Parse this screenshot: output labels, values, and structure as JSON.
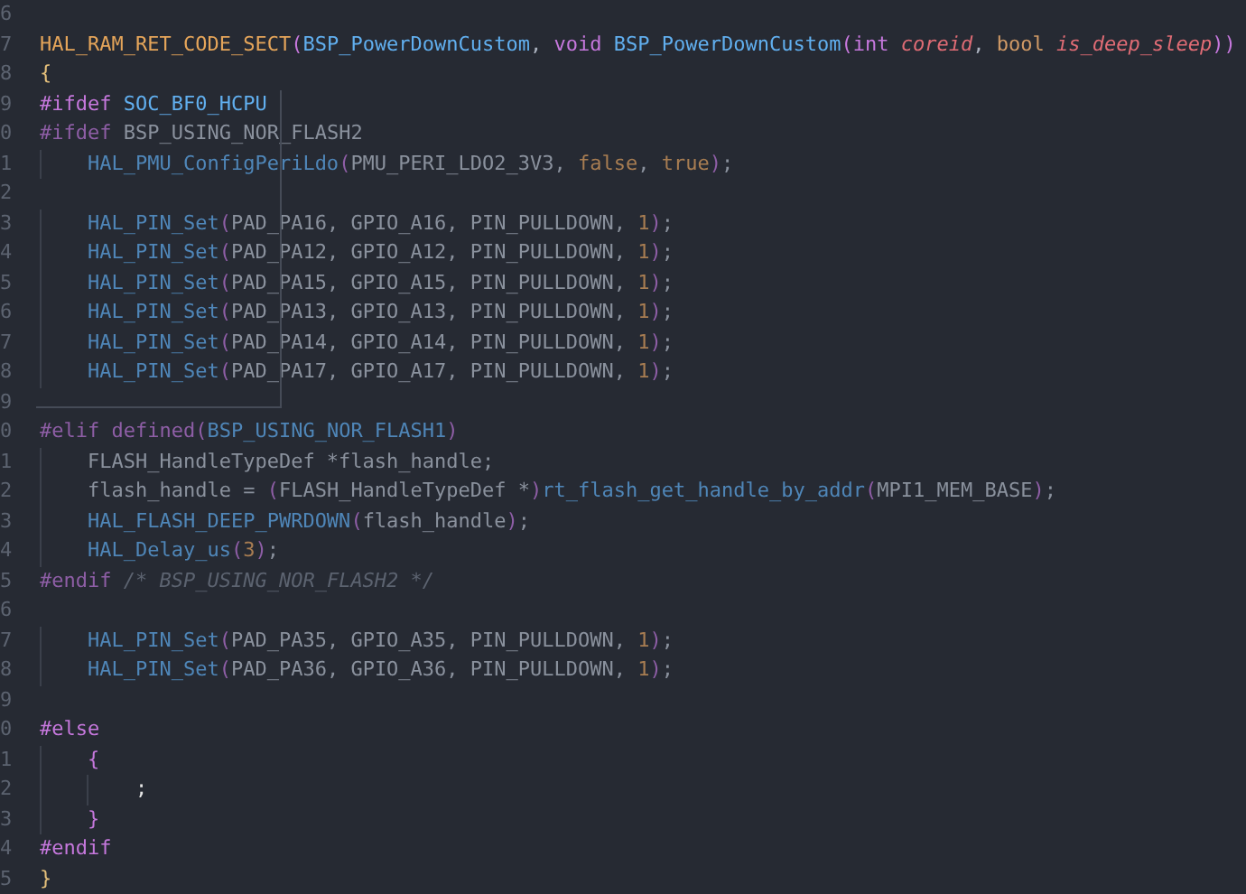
{
  "editor": {
    "lines": [
      {
        "number": "6"
      },
      {
        "number": "7",
        "kind": "top",
        "inactive": false,
        "tokens": [
          {
            "kind": "macro",
            "text": "HAL_RAM_RET_CODE_SECT"
          },
          {
            "kind": "paren",
            "text": "("
          },
          {
            "kind": "func",
            "text": "BSP_PowerDownCustom"
          },
          {
            "kind": "punct",
            "text": ", "
          },
          {
            "kind": "keyword",
            "text": "void "
          },
          {
            "kind": "func",
            "text": "BSP_PowerDownCustom"
          },
          {
            "kind": "paren",
            "text": "("
          },
          {
            "kind": "keyword",
            "text": "int "
          },
          {
            "kind": "param",
            "text": "coreid"
          },
          {
            "kind": "punct",
            "text": ", "
          },
          {
            "kind": "type",
            "text": "bool "
          },
          {
            "kind": "param",
            "text": "is_deep_sleep"
          },
          {
            "kind": "paren",
            "text": "))"
          }
        ]
      },
      {
        "number": "8",
        "kind": "top",
        "inactive": false,
        "tokens": [
          {
            "kind": "brace",
            "text": "{"
          }
        ]
      },
      {
        "number": "9",
        "kind": "top",
        "inactive": false,
        "tokens": [
          {
            "kind": "keyword",
            "text": "#ifdef "
          },
          {
            "kind": "symbol",
            "text": "SOC_BF0_HCPU"
          }
        ]
      },
      {
        "number": "0",
        "kind": "top",
        "inactive": true,
        "tokens": [
          {
            "kind": "keyword",
            "text": "#ifdef "
          },
          {
            "kind": "ident",
            "text": "BSP_USING_NOR_FLASH2"
          }
        ]
      },
      {
        "number": "1",
        "kind": "indented",
        "inactive": true,
        "tokens": [
          {
            "kind": "func",
            "text": "HAL_PMU_ConfigPeriLdo"
          },
          {
            "kind": "paren",
            "text": "("
          },
          {
            "kind": "ident",
            "text": "PMU_PERI_LDO2_3V3, "
          },
          {
            "kind": "number",
            "text": "false"
          },
          {
            "kind": "punct",
            "text": ", "
          },
          {
            "kind": "number",
            "text": "true"
          },
          {
            "kind": "paren",
            "text": ")"
          },
          {
            "kind": "punct",
            "text": ";"
          }
        ]
      },
      {
        "number": "2"
      },
      {
        "number": "3",
        "kind": "indented",
        "inactive": true,
        "tokens": [
          {
            "kind": "func",
            "text": "HAL_PIN_Set"
          },
          {
            "kind": "paren",
            "text": "("
          },
          {
            "kind": "ident",
            "text": "PAD_PA16, GPIO_A16, PIN_PULLDOWN, "
          },
          {
            "kind": "number",
            "text": "1"
          },
          {
            "kind": "paren",
            "text": ")"
          },
          {
            "kind": "punct",
            "text": ";"
          }
        ]
      },
      {
        "number": "4",
        "kind": "indented",
        "inactive": true,
        "tokens": [
          {
            "kind": "func",
            "text": "HAL_PIN_Set"
          },
          {
            "kind": "paren",
            "text": "("
          },
          {
            "kind": "ident",
            "text": "PAD_PA12, GPIO_A12, PIN_PULLDOWN, "
          },
          {
            "kind": "number",
            "text": "1"
          },
          {
            "kind": "paren",
            "text": ")"
          },
          {
            "kind": "punct",
            "text": ";"
          }
        ]
      },
      {
        "number": "5",
        "kind": "indented",
        "inactive": true,
        "tokens": [
          {
            "kind": "func",
            "text": "HAL_PIN_Set"
          },
          {
            "kind": "paren",
            "text": "("
          },
          {
            "kind": "ident",
            "text": "PAD_PA15, GPIO_A15, PIN_PULLDOWN, "
          },
          {
            "kind": "number",
            "text": "1"
          },
          {
            "kind": "paren",
            "text": ")"
          },
          {
            "kind": "punct",
            "text": ";"
          }
        ]
      },
      {
        "number": "6",
        "kind": "indented",
        "inactive": true,
        "tokens": [
          {
            "kind": "func",
            "text": "HAL_PIN_Set"
          },
          {
            "kind": "paren",
            "text": "("
          },
          {
            "kind": "ident",
            "text": "PAD_PA13, GPIO_A13, PIN_PULLDOWN, "
          },
          {
            "kind": "number",
            "text": "1"
          },
          {
            "kind": "paren",
            "text": ")"
          },
          {
            "kind": "punct",
            "text": ";"
          }
        ]
      },
      {
        "number": "7",
        "kind": "indented",
        "inactive": true,
        "tokens": [
          {
            "kind": "func",
            "text": "HAL_PIN_Set"
          },
          {
            "kind": "paren",
            "text": "("
          },
          {
            "kind": "ident",
            "text": "PAD_PA14, GPIO_A14, PIN_PULLDOWN, "
          },
          {
            "kind": "number",
            "text": "1"
          },
          {
            "kind": "paren",
            "text": ")"
          },
          {
            "kind": "punct",
            "text": ";"
          }
        ]
      },
      {
        "number": "8",
        "kind": "indented",
        "inactive": true,
        "tokens": [
          {
            "kind": "func",
            "text": "HAL_PIN_Set"
          },
          {
            "kind": "paren",
            "text": "("
          },
          {
            "kind": "ident",
            "text": "PAD_PA17, GPIO_A17, PIN_PULLDOWN, "
          },
          {
            "kind": "number",
            "text": "1"
          },
          {
            "kind": "paren",
            "text": ")"
          },
          {
            "kind": "punct",
            "text": ";"
          }
        ]
      },
      {
        "number": "9"
      },
      {
        "number": "0",
        "kind": "top",
        "inactive": true,
        "tokens": [
          {
            "kind": "keyword",
            "text": "#elif defined"
          },
          {
            "kind": "paren",
            "text": "("
          },
          {
            "kind": "symbol",
            "text": "BSP_USING_NOR_FLASH1"
          },
          {
            "kind": "paren",
            "text": ")"
          }
        ]
      },
      {
        "number": "1",
        "kind": "indented",
        "inactive": true,
        "tokens": [
          {
            "kind": "ident",
            "text": "FLASH_HandleTypeDef *flash_handle;"
          }
        ]
      },
      {
        "number": "2",
        "kind": "indented",
        "inactive": true,
        "tokens": [
          {
            "kind": "ident",
            "text": "flash_handle = "
          },
          {
            "kind": "paren",
            "text": "("
          },
          {
            "kind": "ident",
            "text": "FLASH_HandleTypeDef *"
          },
          {
            "kind": "paren",
            "text": ")"
          },
          {
            "kind": "func",
            "text": "rt_flash_get_handle_by_addr"
          },
          {
            "kind": "paren",
            "text": "("
          },
          {
            "kind": "ident",
            "text": "MPI1_MEM_BASE"
          },
          {
            "kind": "paren",
            "text": ")"
          },
          {
            "kind": "punct",
            "text": ";"
          }
        ]
      },
      {
        "number": "3",
        "kind": "indented",
        "inactive": true,
        "tokens": [
          {
            "kind": "func",
            "text": "HAL_FLASH_DEEP_PWRDOWN"
          },
          {
            "kind": "paren",
            "text": "("
          },
          {
            "kind": "ident",
            "text": "flash_handle"
          },
          {
            "kind": "paren",
            "text": ")"
          },
          {
            "kind": "punct",
            "text": ";"
          }
        ]
      },
      {
        "number": "4",
        "kind": "indented",
        "inactive": true,
        "tokens": [
          {
            "kind": "func",
            "text": "HAL_Delay_us"
          },
          {
            "kind": "paren",
            "text": "("
          },
          {
            "kind": "number",
            "text": "3"
          },
          {
            "kind": "paren",
            "text": ")"
          },
          {
            "kind": "punct",
            "text": ";"
          }
        ]
      },
      {
        "number": "5",
        "kind": "top",
        "inactive": true,
        "tokens": [
          {
            "kind": "keyword",
            "text": "#endif "
          },
          {
            "kind": "comment",
            "text": "/* BSP_USING_NOR_FLASH2 */"
          }
        ]
      },
      {
        "number": "6"
      },
      {
        "number": "7",
        "kind": "indented",
        "inactive": true,
        "tokens": [
          {
            "kind": "func",
            "text": "HAL_PIN_Set"
          },
          {
            "kind": "paren",
            "text": "("
          },
          {
            "kind": "ident",
            "text": "PAD_PA35, GPIO_A35, PIN_PULLDOWN, "
          },
          {
            "kind": "number",
            "text": "1"
          },
          {
            "kind": "paren",
            "text": ")"
          },
          {
            "kind": "punct",
            "text": ";"
          }
        ]
      },
      {
        "number": "8",
        "kind": "indented",
        "inactive": true,
        "tokens": [
          {
            "kind": "func",
            "text": "HAL_PIN_Set"
          },
          {
            "kind": "paren",
            "text": "("
          },
          {
            "kind": "ident",
            "text": "PAD_PA36, GPIO_A36, PIN_PULLDOWN, "
          },
          {
            "kind": "number",
            "text": "1"
          },
          {
            "kind": "paren",
            "text": ")"
          },
          {
            "kind": "punct",
            "text": ";"
          }
        ]
      },
      {
        "number": "9"
      },
      {
        "number": "0",
        "kind": "top",
        "inactive": false,
        "tokens": [
          {
            "kind": "keyword",
            "text": "#else"
          }
        ]
      },
      {
        "number": "1",
        "kind": "indented",
        "inactive": false,
        "tokens": [
          {
            "kind": "paren",
            "text": "{"
          }
        ]
      },
      {
        "number": "2",
        "kind": "nested",
        "inactive": false,
        "tokens": [
          {
            "kind": "light",
            "text": ";"
          }
        ]
      },
      {
        "number": "3",
        "kind": "indented",
        "inactive": false,
        "tokens": [
          {
            "kind": "paren",
            "text": "}"
          }
        ]
      },
      {
        "number": "4",
        "kind": "top",
        "inactive": false,
        "tokens": [
          {
            "kind": "keyword",
            "text": "#endif"
          }
        ]
      },
      {
        "number": "5",
        "kind": "top",
        "inactive": false,
        "tokens": [
          {
            "kind": "brace",
            "text": "}"
          }
        ]
      }
    ]
  }
}
